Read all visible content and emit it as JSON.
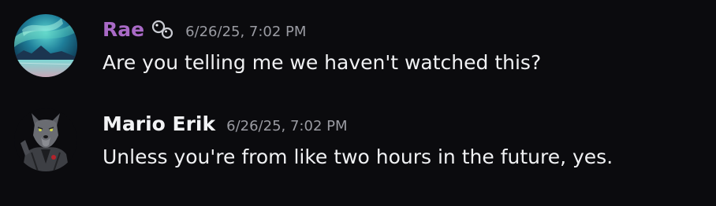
{
  "messages": [
    {
      "author": "Rae",
      "author_color": "#a96ac6",
      "badge_icon": "bubbles-icon",
      "timestamp": "6/26/25, 7:02 PM",
      "text": "Are you telling me we haven't watched this?",
      "avatar_icon": "aurora-avatar"
    },
    {
      "author": "Mario Erik",
      "author_color": "#f2f3f5",
      "timestamp": "6/26/25, 7:02 PM",
      "text": "Unless you're from like two hours in the future, yes.",
      "avatar_icon": "wolf-avatar"
    }
  ]
}
